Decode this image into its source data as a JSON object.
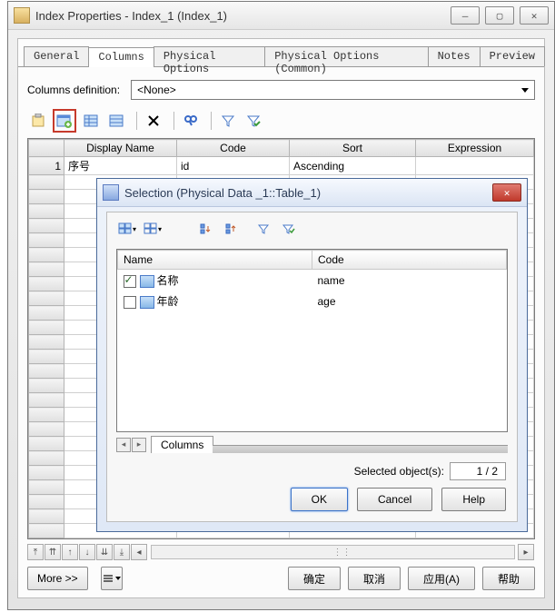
{
  "main": {
    "title": "Index Properties - Index_1 (Index_1)",
    "tabs": [
      "General",
      "Columns",
      "Physical Options",
      "Physical Options (Common)",
      "Notes",
      "Preview"
    ],
    "active_tab": 1,
    "def_label": "Columns definition:",
    "def_value": "<None>",
    "grid": {
      "headers": [
        "",
        "Display Name",
        "Code",
        "Sort",
        "Expression"
      ],
      "rows": [
        {
          "n": "1",
          "display": "序号",
          "code": "id",
          "sort": "Ascending",
          "expr": ""
        }
      ]
    },
    "footer": {
      "more": "More >>",
      "ok": "确定",
      "cancel": "取消",
      "apply": "应用(A)",
      "help": "帮助"
    }
  },
  "dialog": {
    "title": "Selection (Physical Data _1::Table_1)",
    "list": {
      "headers": [
        "Name",
        "Code"
      ],
      "rows": [
        {
          "checked": true,
          "name": "名称",
          "code": "name"
        },
        {
          "checked": false,
          "name": "年龄",
          "code": "age"
        }
      ]
    },
    "tab_label": "Columns",
    "selected_label": "Selected object(s):",
    "selected_value": "1 / 2",
    "buttons": {
      "ok": "OK",
      "cancel": "Cancel",
      "help": "Help"
    }
  }
}
